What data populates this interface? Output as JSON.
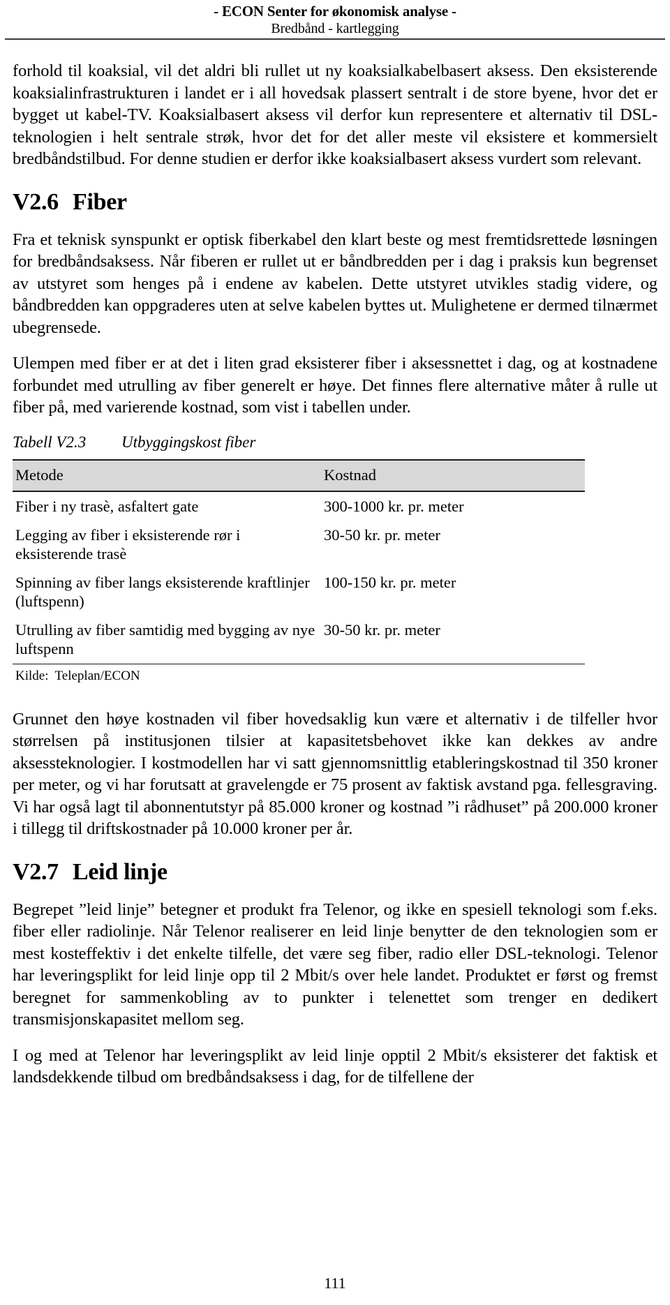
{
  "header": {
    "org_line": "- ECON Senter for økonomisk analyse -",
    "doc_line": "Bredbånd - kartlegging"
  },
  "body": {
    "paragraph_continued": "forhold til koaksial, vil det aldri bli rullet ut ny koaksialkabelbasert aksess. Den eksisterende koaksialinfrastrukturen i landet er i all hovedsak plassert sentralt i de store byene, hvor det er bygget ut kabel-TV. Koaksialbasert aksess vil derfor kun representere et alternativ til DSL-teknologien i helt sentrale strøk, hvor det for det aller meste vil eksistere et kommersielt bredbåndstilbud. For denne studien er derfor ikke koaksialbasert aksess vurdert som relevant.",
    "section_fiber": {
      "number": "V2.6",
      "title": "Fiber",
      "paragraph_1": "Fra et teknisk synspunkt er optisk fiberkabel den klart beste og mest fremtidsrettede løsningen for bredbåndsaksess. Når fiberen er rullet ut er båndbredden per i dag i praksis kun begrenset av utstyret som henges på i endene av kabelen. Dette utstyret utvikles stadig videre, og båndbredden kan oppgraderes uten at selve kabelen byttes ut. Mulighetene er dermed tilnærmet ubegrensede.",
      "paragraph_2": "Ulempen med fiber er at det i liten grad eksisterer fiber i aksessnettet i dag, og at kostnadene forbundet med utrulling av fiber generelt er høye. Det finnes flere alternative måter å rulle ut fiber på, med varierende kostnad, som vist i tabellen under.",
      "paragraph_3": "Grunnet den høye kostnaden vil fiber hovedsaklig kun være et alternativ i de tilfeller hvor størrelsen på institusjonen tilsier at kapasitetsbehovet ikke kan dekkes av andre aksessteknologier. I kostmodellen har vi satt gjennomsnittlig etableringskostnad til 350 kroner per meter, og vi har forutsatt at gravelengde er 75 prosent av faktisk avstand pga. fellesgraving. Vi har også lagt til abonnentutstyr på 85.000 kroner og kostnad ”i rådhuset” på 200.000 kroner i tillegg til driftskostnader på 10.000 kroner per år."
    },
    "table": {
      "caption_number": "Tabell V2.3",
      "caption_title": "Utbyggingskost fiber",
      "columns": [
        "Metode",
        "Kostnad"
      ],
      "rows": [
        {
          "metode": "Fiber i ny trasè, asfaltert gate",
          "kostnad": "300-1000 kr. pr. meter"
        },
        {
          "metode": "Legging av fiber i eksisterende rør i eksisterende trasè",
          "kostnad": "30-50 kr. pr. meter"
        },
        {
          "metode": "Spinning av fiber langs eksisterende kraftlinjer (luftspenn)",
          "kostnad": "100-150 kr. pr. meter"
        },
        {
          "metode": "Utrulling av fiber samtidig med bygging av nye luftspenn",
          "kostnad": "30-50 kr. pr. meter"
        }
      ],
      "source_label": "Kilde:",
      "source_value": "Teleplan/ECON"
    },
    "section_leid_linje": {
      "number": "V2.7",
      "title": "Leid linje",
      "paragraph_1": "Begrepet ”leid linje” betegner et produkt fra Telenor, og ikke en spesiell teknologi som f.eks. fiber eller radiolinje. Når Telenor realiserer en leid linje benytter de den teknologien som er mest kosteffektiv i det enkelte tilfelle, det være seg fiber, radio eller DSL-teknologi. Telenor har leveringsplikt for leid linje opp til 2 Mbit/s over hele landet. Produktet er først og fremst beregnet for sammenkobling av to punkter i telenettet som trenger en dedikert transmisjonskapasitet mellom seg.",
      "paragraph_2": "I og med at Telenor har leveringsplikt av leid linje opptil 2 Mbit/s eksisterer det faktisk et landsdekkende tilbud om bredbåndsaksess i dag, for de tilfellene der"
    }
  },
  "footer": {
    "page_number": "111"
  }
}
